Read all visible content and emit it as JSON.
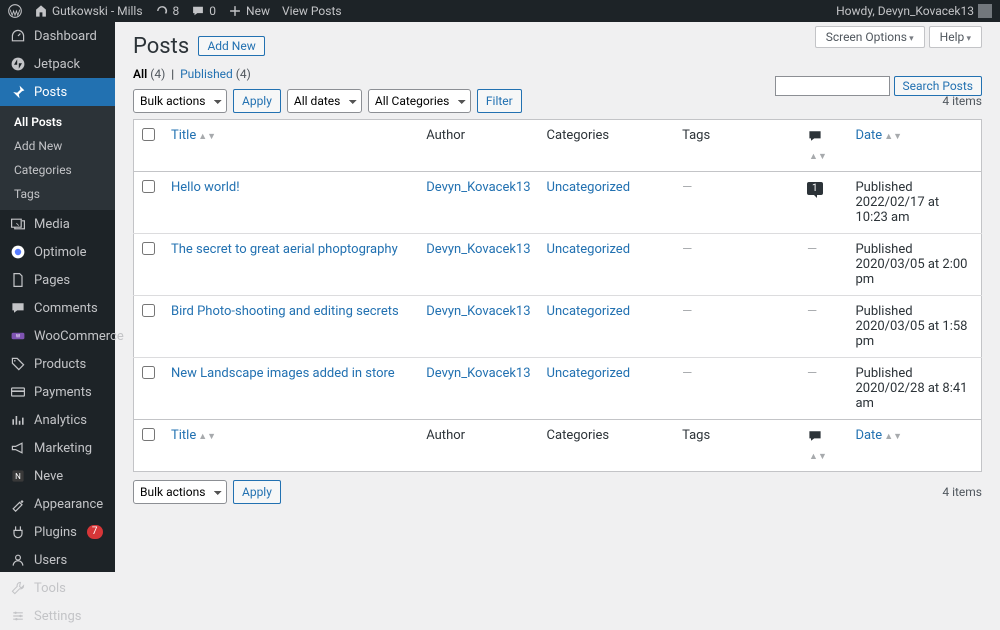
{
  "adminbar": {
    "site_name": "Gutkowski - Mills",
    "updates": "8",
    "comments": "0",
    "new_label": "New",
    "view_posts": "View Posts",
    "howdy": "Howdy, Devyn_Kovacek13"
  },
  "sidebar": {
    "items": [
      {
        "icon": "dashboard",
        "label": "Dashboard"
      },
      {
        "icon": "jetpack",
        "label": "Jetpack"
      },
      {
        "icon": "pin",
        "label": "Posts",
        "current": true
      },
      {
        "icon": "media",
        "label": "Media"
      },
      {
        "icon": "optimole",
        "label": "Optimole"
      },
      {
        "icon": "page",
        "label": "Pages"
      },
      {
        "icon": "comment",
        "label": "Comments"
      },
      {
        "icon": "woo",
        "label": "WooCommerce"
      },
      {
        "icon": "product",
        "label": "Products"
      },
      {
        "icon": "payments",
        "label": "Payments"
      },
      {
        "icon": "analytics",
        "label": "Analytics"
      },
      {
        "icon": "marketing",
        "label": "Marketing"
      },
      {
        "icon": "neve",
        "label": "Neve"
      },
      {
        "icon": "appearance",
        "label": "Appearance"
      },
      {
        "icon": "plugins",
        "label": "Plugins",
        "badge": "7"
      },
      {
        "icon": "users",
        "label": "Users"
      },
      {
        "icon": "tools",
        "label": "Tools"
      },
      {
        "icon": "settings",
        "label": "Settings"
      }
    ],
    "submenu": [
      {
        "label": "All Posts",
        "current": true
      },
      {
        "label": "Add New"
      },
      {
        "label": "Categories"
      },
      {
        "label": "Tags"
      }
    ]
  },
  "header": {
    "screen_options": "Screen Options",
    "help": "Help",
    "page_title": "Posts",
    "add_new": "Add New"
  },
  "filter": {
    "all": "All",
    "all_count": "(4)",
    "sep": "|",
    "published": "Published",
    "published_count": "(4)"
  },
  "search": {
    "button": "Search Posts"
  },
  "nav": {
    "bulk": "Bulk actions",
    "apply": "Apply",
    "dates": "All dates",
    "cats": "All Categories",
    "filter": "Filter",
    "items": "4 items"
  },
  "table": {
    "cols": {
      "title": "Title",
      "author": "Author",
      "categories": "Categories",
      "tags": "Tags",
      "date": "Date"
    },
    "rows": [
      {
        "title": "Hello world!",
        "author": "Devyn_Kovacek13",
        "cat": "Uncategorized",
        "tags": "—",
        "comments": "1",
        "status": "Published",
        "date": "2022/02/17 at 10:23 am"
      },
      {
        "title": "The secret to great aerial phoptography",
        "author": "Devyn_Kovacek13",
        "cat": "Uncategorized",
        "tags": "—",
        "comments": "",
        "status": "Published",
        "date": "2020/03/05 at 2:00 pm"
      },
      {
        "title": "Bird Photo-shooting and editing secrets",
        "author": "Devyn_Kovacek13",
        "cat": "Uncategorized",
        "tags": "—",
        "comments": "",
        "status": "Published",
        "date": "2020/03/05 at 1:58 pm"
      },
      {
        "title": "New Landscape images added in store",
        "author": "Devyn_Kovacek13",
        "cat": "Uncategorized",
        "tags": "—",
        "comments": "",
        "status": "Published",
        "date": "2020/02/28 at 8:41 am"
      }
    ]
  }
}
